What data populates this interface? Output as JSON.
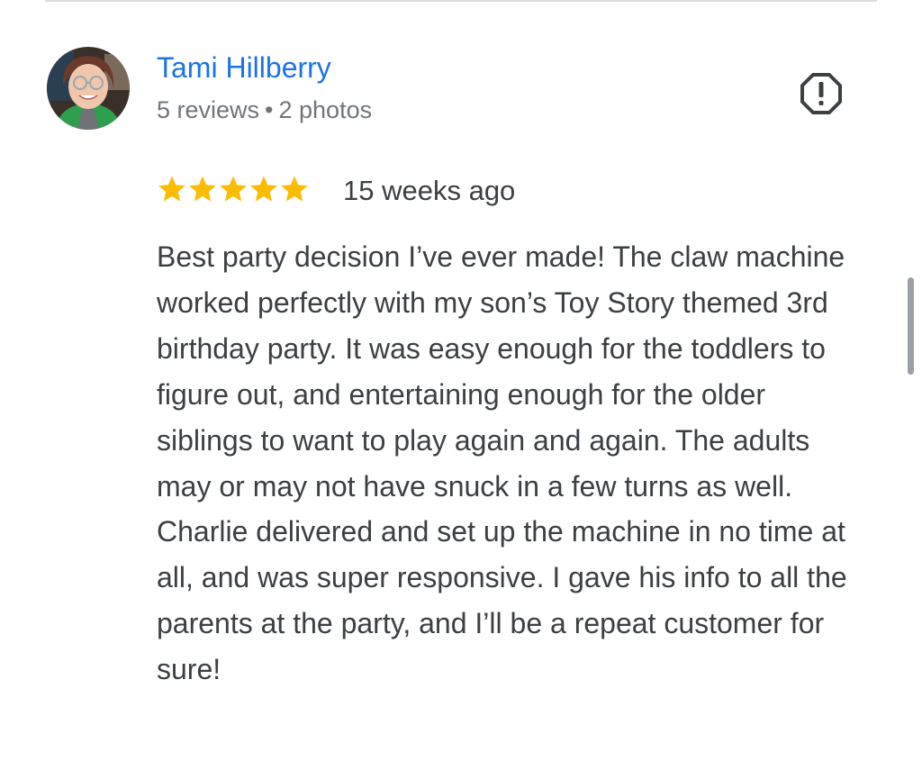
{
  "review": {
    "reviewer_name": "Tami Hillberry",
    "reviewer_reviews": "5 reviews",
    "meta_separator": "•",
    "reviewer_photos": "2 photos",
    "rating": 5,
    "rating_max": 5,
    "time_ago": "15 weeks ago",
    "text": "Best party decision I’ve ever made! The claw machine worked perfectly with my son’s Toy Story themed 3rd birthday party. It was easy enough for the toddlers to figure out, and entertaining enough for the older siblings to want to play again and again. The adults may or may not have snuck in a few turns as well. Charlie delivered and set up the machine in no time at all, and was super responsive. I gave his info to all the parents at the party, and I’ll be a repeat customer for sure!"
  },
  "icons": {
    "report": "report-flag-icon",
    "star": "star-icon"
  },
  "colors": {
    "name_link": "#1a73e8",
    "star": "#fbbc04",
    "meta_text": "#70757a",
    "body_text": "#3c4043"
  }
}
